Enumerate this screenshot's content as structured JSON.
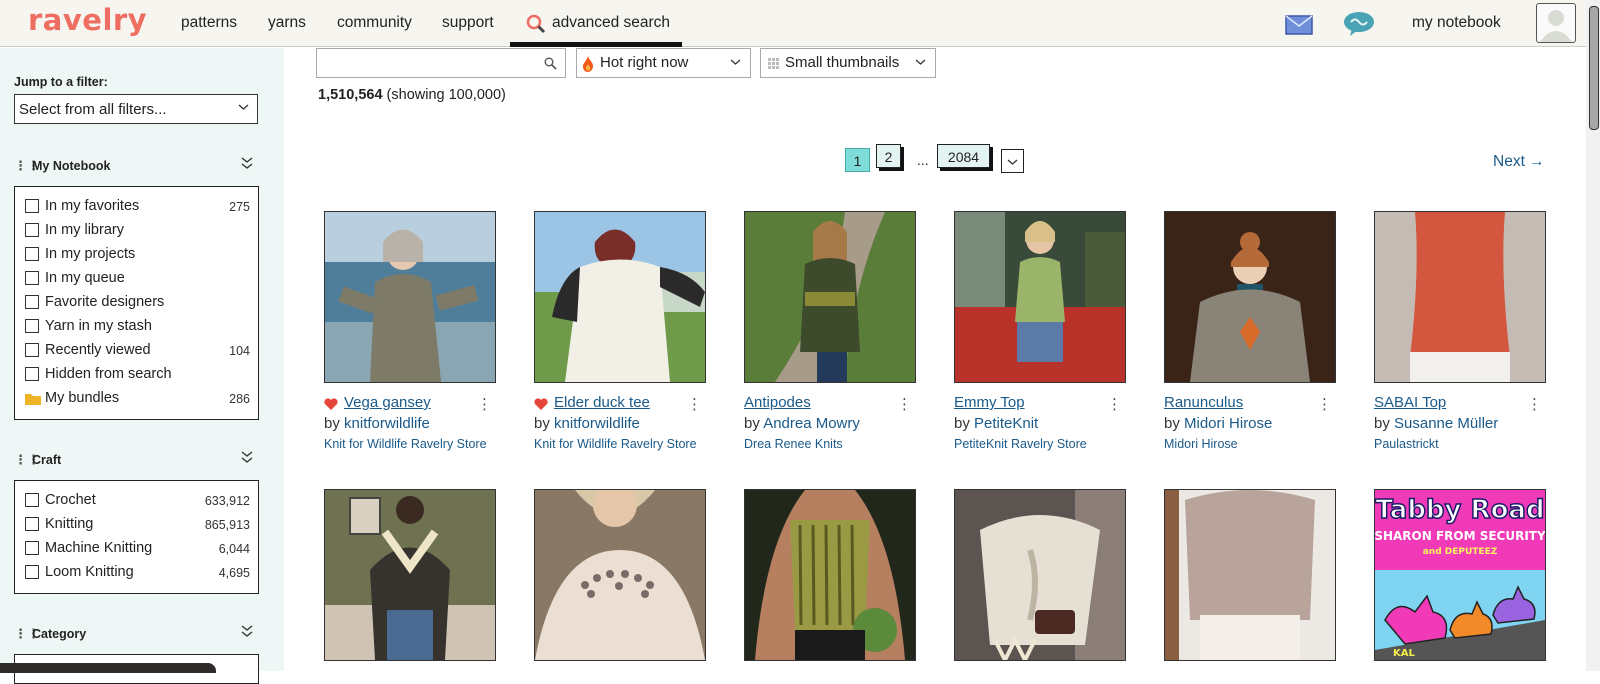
{
  "nav": {
    "logo": "ravelry",
    "links": [
      "patterns",
      "yarns",
      "community",
      "support"
    ],
    "advanced": "advanced search",
    "notebook": "my notebook"
  },
  "sidebar": {
    "jump_label": "Jump to a filter:",
    "jump_select": "Select from all filters...",
    "my_notebook": {
      "title": "My Notebook",
      "items": [
        {
          "label": "In my favorites",
          "count": "275"
        },
        {
          "label": "In my library",
          "count": ""
        },
        {
          "label": "In my projects",
          "count": ""
        },
        {
          "label": "In my queue",
          "count": ""
        },
        {
          "label": "Favorite designers",
          "count": ""
        },
        {
          "label": "Yarn in my stash",
          "count": ""
        },
        {
          "label": "Recently viewed",
          "count": "104"
        },
        {
          "label": "Hidden from search",
          "count": ""
        },
        {
          "label": "My bundles",
          "count": "286"
        }
      ]
    },
    "craft": {
      "title": "Craft",
      "items": [
        {
          "label": "Crochet",
          "count": "633,912"
        },
        {
          "label": "Knitting",
          "count": "865,913"
        },
        {
          "label": "Machine Knitting",
          "count": "6,044"
        },
        {
          "label": "Loom Knitting",
          "count": "4,695"
        }
      ]
    },
    "category": {
      "title": "Category"
    }
  },
  "search": {
    "query": "",
    "sort": "Hot right now",
    "view": "Small thumbnails",
    "result_count": "1,510,564",
    "result_note": "(showing 100,000)"
  },
  "pager": {
    "current": "1",
    "page2": "2",
    "ellipsis": "...",
    "last": "2084",
    "next": "Next →"
  },
  "patterns": [
    {
      "title": "Vega gansey",
      "by": "by",
      "designer": "knitforwildlife",
      "store": "Knit for Wildlife Ravelry Store",
      "favorite": true
    },
    {
      "title": "Elder duck tee",
      "by": "by",
      "designer": "knitforwildlife",
      "store": "Knit for Wildlife Ravelry Store",
      "favorite": true
    },
    {
      "title": "Antipodes",
      "by": "by",
      "designer": "Andrea Mowry",
      "store": "Drea Renee Knits",
      "favorite": false
    },
    {
      "title": "Emmy Top",
      "by": "by",
      "designer": "PetiteKnit",
      "store": "PetiteKnit Ravelry Store",
      "favorite": false
    },
    {
      "title": "Ranunculus",
      "by": "by",
      "designer": "Midori Hirose",
      "store": "Midori Hirose",
      "favorite": false
    },
    {
      "title": "SABAI Top",
      "by": "by",
      "designer": "Susanne Müller",
      "store": "Paulastrickt",
      "favorite": false
    }
  ],
  "tabby": {
    "line1": "Tabby Road",
    "line2": "SHARON FROM SECURITY",
    "line3": "and DEPUTEEZ",
    "tag": "KAL"
  },
  "colors": {
    "brand": "#ee6e62",
    "link": "#1a5a8a",
    "sidebar_bg": "#eef7f5",
    "pager_current": "#7fdcd8"
  }
}
